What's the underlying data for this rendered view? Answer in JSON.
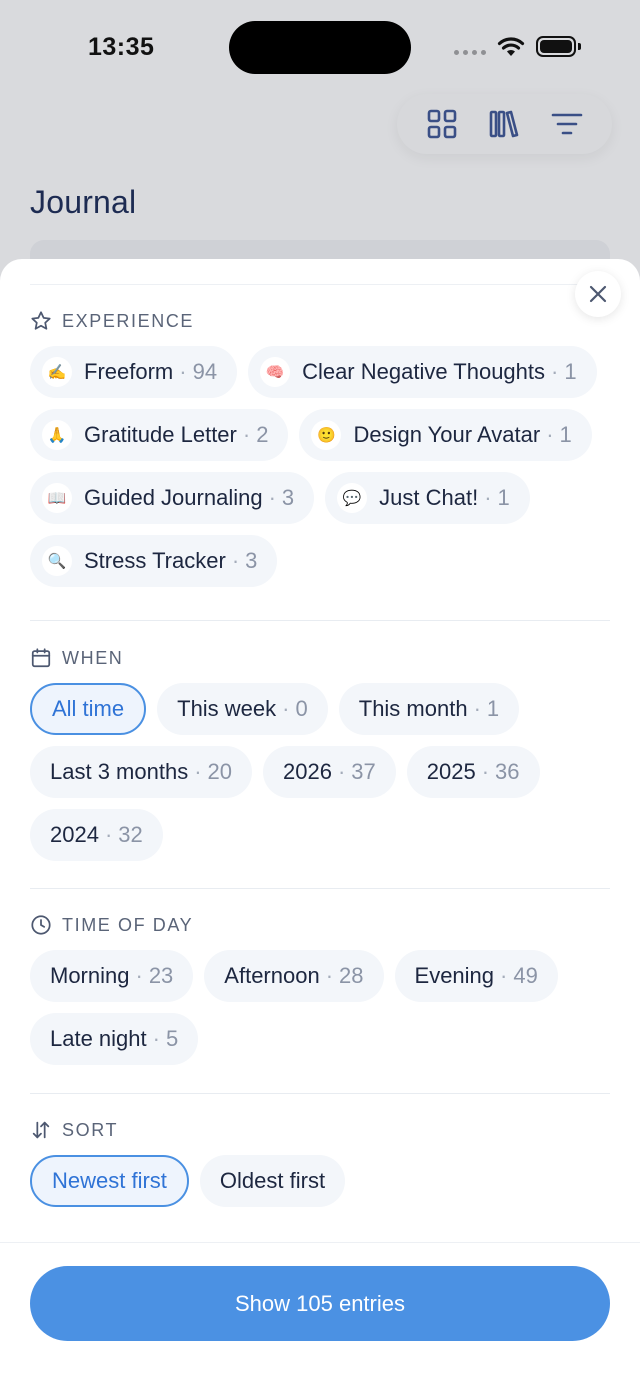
{
  "status_bar": {
    "time": "13:35"
  },
  "background": {
    "title": "Journal"
  },
  "toolbar": {
    "icons": [
      "grid-icon",
      "library-icon",
      "filter-icon"
    ]
  },
  "sections": {
    "experience": {
      "title": "EXPERIENCE",
      "items": [
        {
          "label": "Freeform",
          "count": "94",
          "icon": "✍️"
        },
        {
          "label": "Clear Negative Thoughts",
          "count": "1",
          "icon": "🧠"
        },
        {
          "label": "Gratitude Letter",
          "count": "2",
          "icon": "🙏"
        },
        {
          "label": "Design Your Avatar",
          "count": "1",
          "icon": "🙂"
        },
        {
          "label": "Guided Journaling",
          "count": "3",
          "icon": "📖"
        },
        {
          "label": "Just Chat!",
          "count": "1",
          "icon": "💬"
        },
        {
          "label": "Stress Tracker",
          "count": "3",
          "icon": "🔍"
        }
      ]
    },
    "when": {
      "title": "WHEN",
      "selected": "All time",
      "items": [
        {
          "label": "All time",
          "count": ""
        },
        {
          "label": "This week",
          "count": "0"
        },
        {
          "label": "This month",
          "count": "1"
        },
        {
          "label": "Last 3 months",
          "count": "20"
        },
        {
          "label": "2026",
          "count": "37"
        },
        {
          "label": "2025",
          "count": "36"
        },
        {
          "label": "2024",
          "count": "32"
        }
      ]
    },
    "time_of_day": {
      "title": "TIME OF DAY",
      "items": [
        {
          "label": "Morning",
          "count": "23"
        },
        {
          "label": "Afternoon",
          "count": "28"
        },
        {
          "label": "Evening",
          "count": "49"
        },
        {
          "label": "Late night",
          "count": "5"
        }
      ]
    },
    "sort": {
      "title": "SORT",
      "selected": "Newest first",
      "items": [
        {
          "label": "Newest first",
          "count": ""
        },
        {
          "label": "Oldest first",
          "count": ""
        }
      ]
    }
  },
  "cta": {
    "label": "Show 105 entries"
  },
  "colors": {
    "accent": "#4b91e3",
    "chip_bg": "#f3f6fa",
    "selected_border": "#4a90e2",
    "text": "#1d2740"
  }
}
